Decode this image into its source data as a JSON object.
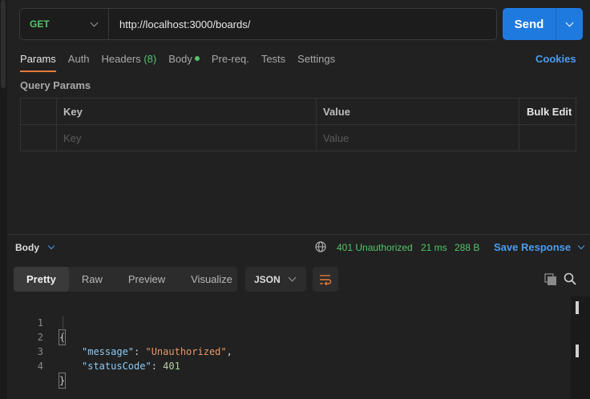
{
  "request": {
    "method": "GET",
    "url": "http://localhost:3000/boards/",
    "send_label": "Send"
  },
  "tabs": {
    "params": "Params",
    "auth": "Auth",
    "headers": "Headers",
    "headers_count": "(8)",
    "body": "Body",
    "prereq": "Pre-req.",
    "tests": "Tests",
    "settings": "Settings",
    "cookies": "Cookies"
  },
  "query_params": {
    "title": "Query Params",
    "columns": [
      "Key",
      "Value"
    ],
    "bulk_edit": "Bulk Edit",
    "key_placeholder": "Key",
    "value_placeholder": "Value"
  },
  "response": {
    "body_label": "Body",
    "status": "401 Unauthorized",
    "time": "21 ms",
    "size": "288 B",
    "save_label": "Save Response",
    "views": [
      "Pretty",
      "Raw",
      "Preview",
      "Visualize"
    ],
    "format": "JSON",
    "lines": [
      {
        "n": "1",
        "open": "{"
      },
      {
        "n": "2",
        "key": "\"message\"",
        "value": "\"Unauthorized\"",
        "trail": ","
      },
      {
        "n": "3",
        "key": "\"statusCode\"",
        "value": "401",
        "trail": ""
      },
      {
        "n": "4",
        "close": "}"
      }
    ]
  },
  "colors": {
    "accent": "#1f7ae0",
    "success": "#55c46a",
    "link": "#4a9cf0",
    "active_tab": "#e57a3c"
  }
}
